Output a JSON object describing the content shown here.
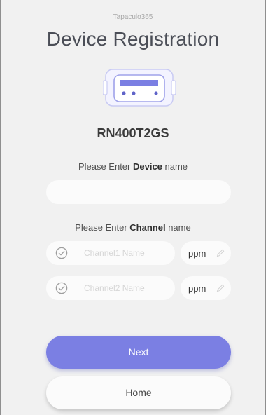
{
  "header": {
    "brand": "Tapaculo365",
    "title": "Device Registration"
  },
  "device": {
    "icon": "device-icon",
    "model": "RN400T2GS",
    "prompt_pre": "Please Enter ",
    "prompt_bold": "Device",
    "prompt_post": " name",
    "name_value": ""
  },
  "channels": {
    "prompt_pre": "Please Enter ",
    "prompt_bold": "Channel",
    "prompt_post": " name",
    "items": [
      {
        "placeholder": "Channel1 Name",
        "unit": "ppm",
        "icon": "check-circle-icon",
        "edit_icon": "pencil-icon"
      },
      {
        "placeholder": "Channel2 Name",
        "unit": "ppm",
        "icon": "check-circle-icon",
        "edit_icon": "pencil-icon"
      }
    ]
  },
  "actions": {
    "next_label": "Next",
    "home_label": "Home"
  },
  "colors": {
    "accent": "#7b7fe3",
    "background": "#f1f1f1",
    "field": "#fbfbfb"
  }
}
